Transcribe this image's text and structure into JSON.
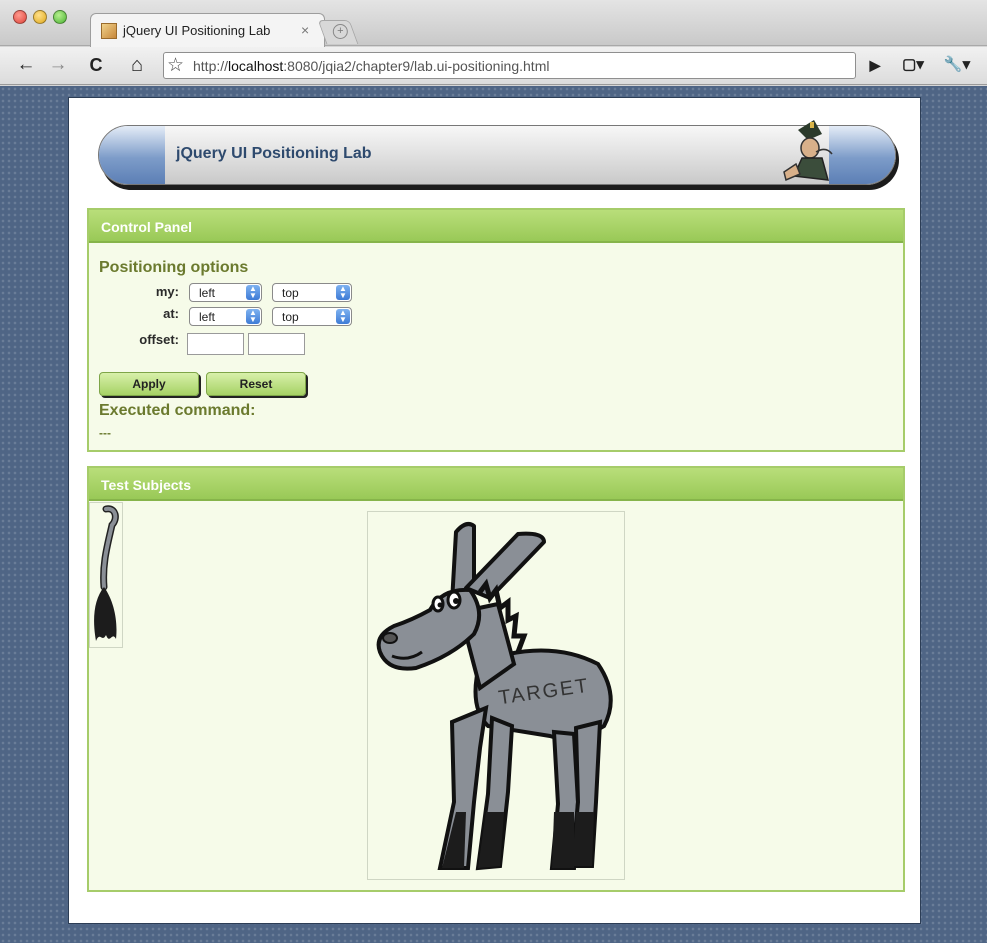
{
  "browser": {
    "tab_title": "jQuery UI Positioning Lab",
    "tab_close": "×",
    "new_tab": "+",
    "back": "←",
    "forward": "→",
    "reload": "C",
    "home": "⌂",
    "bookmark": "☆",
    "url_scheme": "http://",
    "url_host": "localhost",
    "url_rest": ":8080/jqia2/chapter9/lab.ui-positioning.html",
    "play": "▶",
    "page_menu": "▢▾",
    "wrench_menu": "🔧▾"
  },
  "banner": {
    "title": "jQuery UI Positioning Lab"
  },
  "control_panel": {
    "title": "Control Panel",
    "section_title": "Positioning options",
    "my_label": "my:",
    "at_label": "at:",
    "offset_label": "offset:",
    "my_horizontal": "left",
    "my_vertical": "top",
    "at_horizontal": "left",
    "at_vertical": "top",
    "offset_x": "",
    "offset_y": "",
    "apply_label": "Apply",
    "reset_label": "Reset",
    "executed_label": "Executed command:",
    "executed_value": "---"
  },
  "test_subjects": {
    "title": "Test Subjects",
    "target_text": "TARGET"
  },
  "colors": {
    "panel_green": "#a6cc6a",
    "panel_bg": "#f6fbe9",
    "heading_olive": "#6b7a2e",
    "page_blue": "#4f6585"
  }
}
